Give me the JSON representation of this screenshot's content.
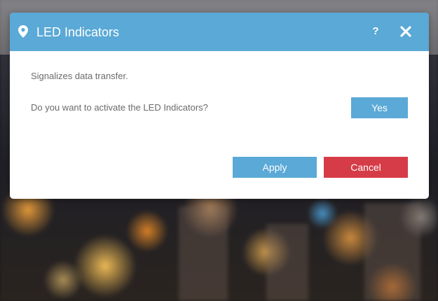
{
  "dialog": {
    "title": "LED Indicators",
    "header_icon": "map-pin-icon",
    "help_icon": "question-mark-icon",
    "help_label": "?",
    "close_icon": "close-icon",
    "description": "Signalizes data transfer.",
    "question": "Do you want to activate the LED Indicators?",
    "toggle_label": "Yes",
    "apply_label": "Apply",
    "cancel_label": "Cancel"
  },
  "colors": {
    "accent": "#5aa9d6",
    "danger": "#d63c47",
    "body_text": "#6a6a6a"
  }
}
